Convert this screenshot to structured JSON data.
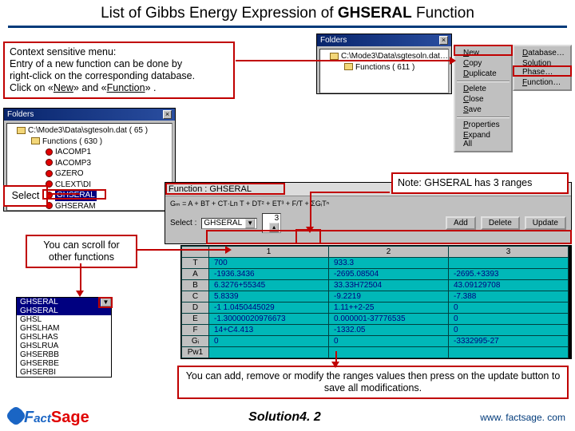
{
  "title_prefix": "List of Gibbs Energy Expression of ",
  "title_bold": "GHSERAL",
  "title_suffix": " Function",
  "callout_context": {
    "line1": "Context sensitive menu:",
    "line2": "Entry of a new function can be done by",
    "line3": "right-click on the corresponding database.",
    "line4_pre": "Click on «",
    "line4_new": "New",
    "line4_mid": "» and «",
    "line4_func": "Function",
    "line4_post": "» ."
  },
  "callout_select": "Select",
  "callout_note": "Note:  GHSERAL has 3 ranges",
  "callout_scroll_l1": "You can scroll for",
  "callout_scroll_l2": "other functions",
  "callout_bottom": "You can add, remove or modify the ranges values then press on the update button to save all modifications.",
  "top_panel": {
    "title": "Folders",
    "root": "C:\\Mode3\\Data\\sgtesoln.dat…",
    "functions_label": "Functions  ( 611 )"
  },
  "ctx_menu": {
    "items": [
      "New",
      "Copy",
      "Duplicate",
      "Delete",
      "Close",
      "Save",
      "Properties",
      "Expand All"
    ]
  },
  "sub_menu": {
    "items": [
      "Database…",
      "Solution Phase…",
      "Function…"
    ]
  },
  "left_panel": {
    "title": "Folders",
    "root": "C:\\Mode3\\Data\\sgtesoln.dat  ( 65 )",
    "functions": "Functions  ( 630 )",
    "items": [
      "IACOMP1",
      "IACOMP3",
      "GZERO",
      "CLEXT\\DI"
    ],
    "selected": "GHSERAL",
    "after": "GHSERAM"
  },
  "function_block": {
    "title": "Function : GHSERAL",
    "formula": "Gₘ = A + BT + CT·Ln T + DT² + ET³ + F/T + ΣGᵢTⁿ",
    "select_label": "Select :",
    "selected": "GHSERAL",
    "ranges_value": "3",
    "buttons": {
      "add": "Add",
      "delete": "Delete",
      "update": "Update"
    }
  },
  "listbox": {
    "items": [
      "GHSERAL",
      "GHSERAL",
      "GHSL",
      "GHSLHAM",
      "GHSLHAS",
      "GHSLRUA",
      "GHSERBB",
      "GHSERBE",
      "GHSERBI"
    ]
  },
  "chart_data": {
    "type": "table",
    "columns": [
      "",
      "1",
      "2",
      "3"
    ],
    "rows": [
      {
        "label": "T",
        "values": [
          "700",
          "933.3",
          ""
        ]
      },
      {
        "label": "A",
        "values": [
          "-1936.3436",
          "-2695.08504",
          "-2695.+3393"
        ]
      },
      {
        "label": "B",
        "values": [
          "6.3276+55345",
          "33.33H72504",
          "43.09129708"
        ]
      },
      {
        "label": "C",
        "values": [
          "5.8339",
          "-9.2219",
          "-7.388"
        ]
      },
      {
        "label": "D",
        "values": [
          "-1 1.0450445029",
          "1.11++2-25",
          "0"
        ]
      },
      {
        "label": "E",
        "values": [
          "-1.30000020976673",
          "0.000001-37776535",
          "0"
        ]
      },
      {
        "label": "F",
        "values": [
          "14+C4.413",
          "-1332.05",
          "0"
        ]
      },
      {
        "label": "Gᵢ",
        "values": [
          "0",
          "0",
          "-3332995-27"
        ]
      },
      {
        "label": "Pw1",
        "values": [
          "",
          "",
          ""
        ]
      }
    ]
  },
  "footer": {
    "center": "Solution4. 2",
    "url": "www. factsage. com"
  }
}
